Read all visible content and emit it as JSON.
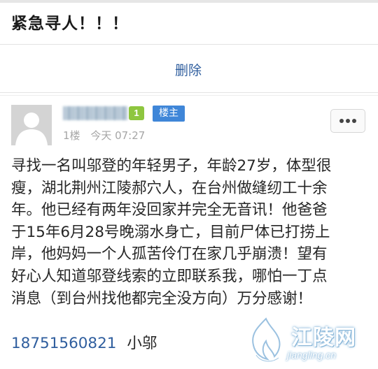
{
  "thread": {
    "title": "紧急寻人！！！"
  },
  "actions": {
    "delete_label": "删除",
    "more_icon": "ellipsis-icon"
  },
  "post": {
    "level": "1",
    "owner_badge": "楼主",
    "floor": "1楼",
    "time": "今天 07:27",
    "body_lines": [
      "寻找一名叫邬登的年轻男子，年龄27岁，体型很",
      "瘦，湖北荆州江陵郝穴人，在台州做缝纫工十余",
      "年。他已经有两年没回家并完全无音讯！他爸爸",
      "于15年6月28号晚溺水身亡，目前尸体已打捞上",
      "岸，他妈妈一个人孤苦伶仃在家几乎崩溃！望有",
      "好心人知道邬登线索的立即联系我，哪怕一丁点",
      "消息（到台州找他都完全没方向）万分感谢！"
    ],
    "phone": "18751560821",
    "signature": "小邬"
  },
  "watermark": {
    "name": "江陵网",
    "domain": "jiangling.cn"
  },
  "colors": {
    "link": "#2f5e9e",
    "owner_badge": "#3f86d8",
    "level_badge": "#8ec63f",
    "meta_text": "#a6a6a6"
  }
}
